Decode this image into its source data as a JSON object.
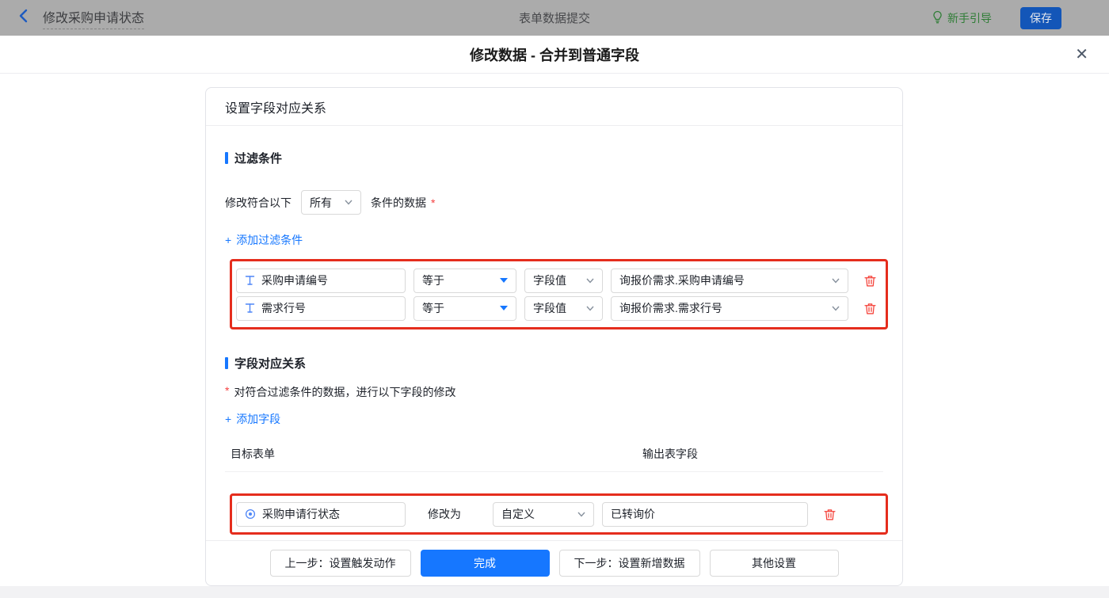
{
  "topbar": {
    "title": "修改采购申请状态",
    "center_title": "表单数据提交",
    "guide_label": "新手引导",
    "save_label": "保存"
  },
  "modal": {
    "title": "修改数据 - 合并到普通字段",
    "close_icon": "✕"
  },
  "card": {
    "header": "设置字段对应关系",
    "filter_section": {
      "title": "过滤条件",
      "match_prefix": "修改符合以下",
      "match_value": "所有",
      "match_suffix": "条件的数据",
      "required_mark": "*",
      "add_icon": "+",
      "add_label": "添加过滤条件",
      "rows": [
        {
          "field": "采购申请编号",
          "operator": "等于",
          "value_type": "字段值",
          "value": "询报价需求.采购申请编号"
        },
        {
          "field": "需求行号",
          "operator": "等于",
          "value_type": "字段值",
          "value": "询报价需求.需求行号"
        }
      ]
    },
    "mapping_section": {
      "title": "字段对应关系",
      "required_mark": "*",
      "description": "对符合过滤条件的数据，进行以下字段的修改",
      "add_icon": "+",
      "add_label": "添加字段",
      "col_target": "目标表单",
      "col_output": "输出表字段",
      "rows": [
        {
          "field": "采购申请行状态",
          "action": "修改为",
          "value_type": "自定义",
          "value": "已转询价"
        }
      ]
    },
    "footer": {
      "prev_label": "上一步：设置触发动作",
      "done_label": "完成",
      "next_label": "下一步：设置新增数据",
      "other_label": "其他设置"
    }
  },
  "colors": {
    "accent_blue": "#1677ff",
    "highlight_red": "#e52d1d",
    "danger_red": "#f53f3f",
    "guide_green": "#2f7d36",
    "topbar_dimmed": "#ababab"
  }
}
